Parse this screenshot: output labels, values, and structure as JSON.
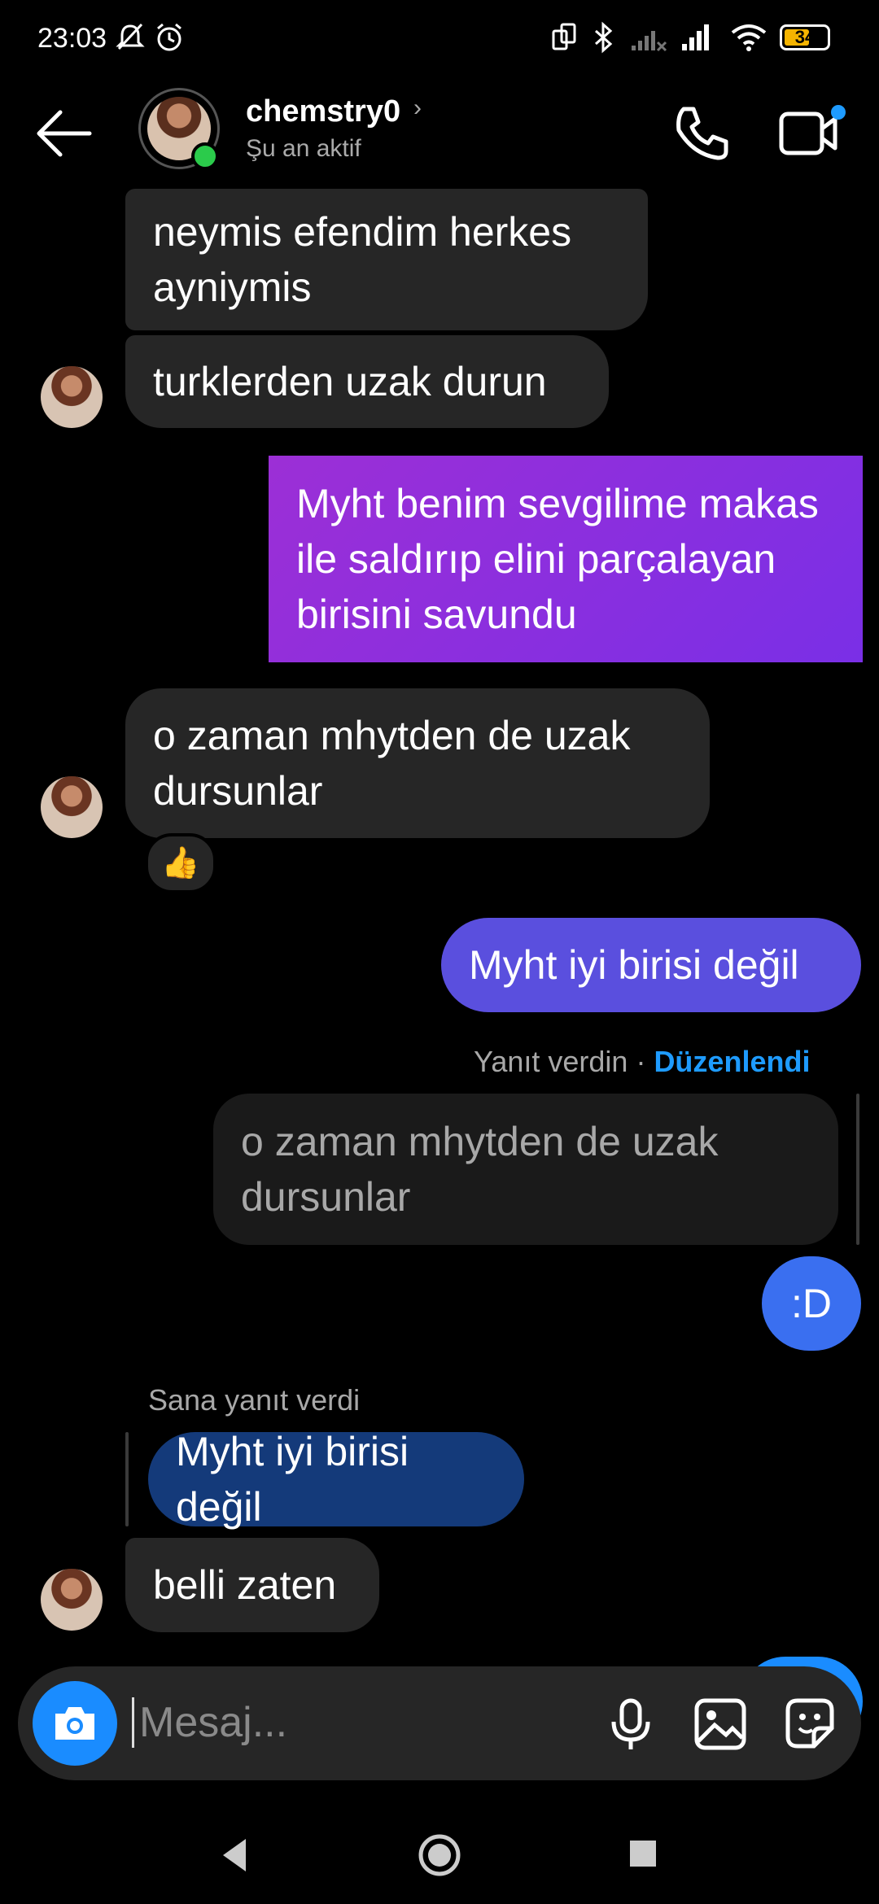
{
  "status_bar": {
    "time": "23:03",
    "battery": "34"
  },
  "header": {
    "username": "chemstry0",
    "status": "Şu an aktif"
  },
  "messages": {
    "m1": "neymis efendim herkes ayniymis",
    "m2": "turklerden uzak durun",
    "m3": "Myht benim sevgilime makas ile saldırıp elini parçalayan birisini savundu",
    "m4": "o zaman mhytden de uzak dursunlar",
    "m4_reaction": "👍",
    "m5": "Myht iyi birisi değil",
    "m6_meta_prefix": "Yanıt verdin · ",
    "m6_meta_edited": "Düzenlendi",
    "m6_quoted": "o zaman mhytden de uzak dursunlar",
    "m6": ":D",
    "m7_meta": "Sana yanıt verdi",
    "m7_quoted": "Myht iyi birisi değil",
    "m8": "belli zaten"
  },
  "composer": {
    "placeholder": "Mesaj..."
  },
  "colors": {
    "purple": "#8a2be2",
    "indigo": "#5b4fe0",
    "blue": "#3a6ff0",
    "dark_blue": "#143a7a",
    "link": "#1e9bff"
  }
}
